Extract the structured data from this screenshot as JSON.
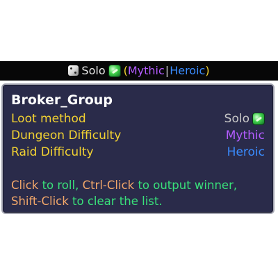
{
  "topbar": {
    "dice_icon": "dice-icon",
    "solo_label": "Solo",
    "gem_icon": "green-gem-icon",
    "paren_open": "(",
    "mythic": "Mythic",
    "separator": "|",
    "heroic": "Heroic",
    "paren_close": ")"
  },
  "tooltip": {
    "title": "Broker_Group",
    "rows": [
      {
        "label": "Loot method",
        "value": "Solo"
      },
      {
        "label": "Dungeon Difficulty",
        "value": "Mythic"
      },
      {
        "label": "Raid Difficulty",
        "value": "Heroic"
      }
    ],
    "hint": {
      "click": "Click",
      "to_roll": " to roll, ",
      "ctrl_click": "Ctrl-Click",
      "to_output": " to output winner,",
      "shift_click": "Shift-Click",
      "to_clear": " to clear the list."
    }
  },
  "colors": {
    "label_yellow": "#f2d232",
    "mythic_purple": "#b35cff",
    "heroic_blue": "#3a8cff",
    "key_orange": "#f2a76a",
    "action_green": "#39e07a",
    "panel_bg": "#2a2b4a"
  }
}
